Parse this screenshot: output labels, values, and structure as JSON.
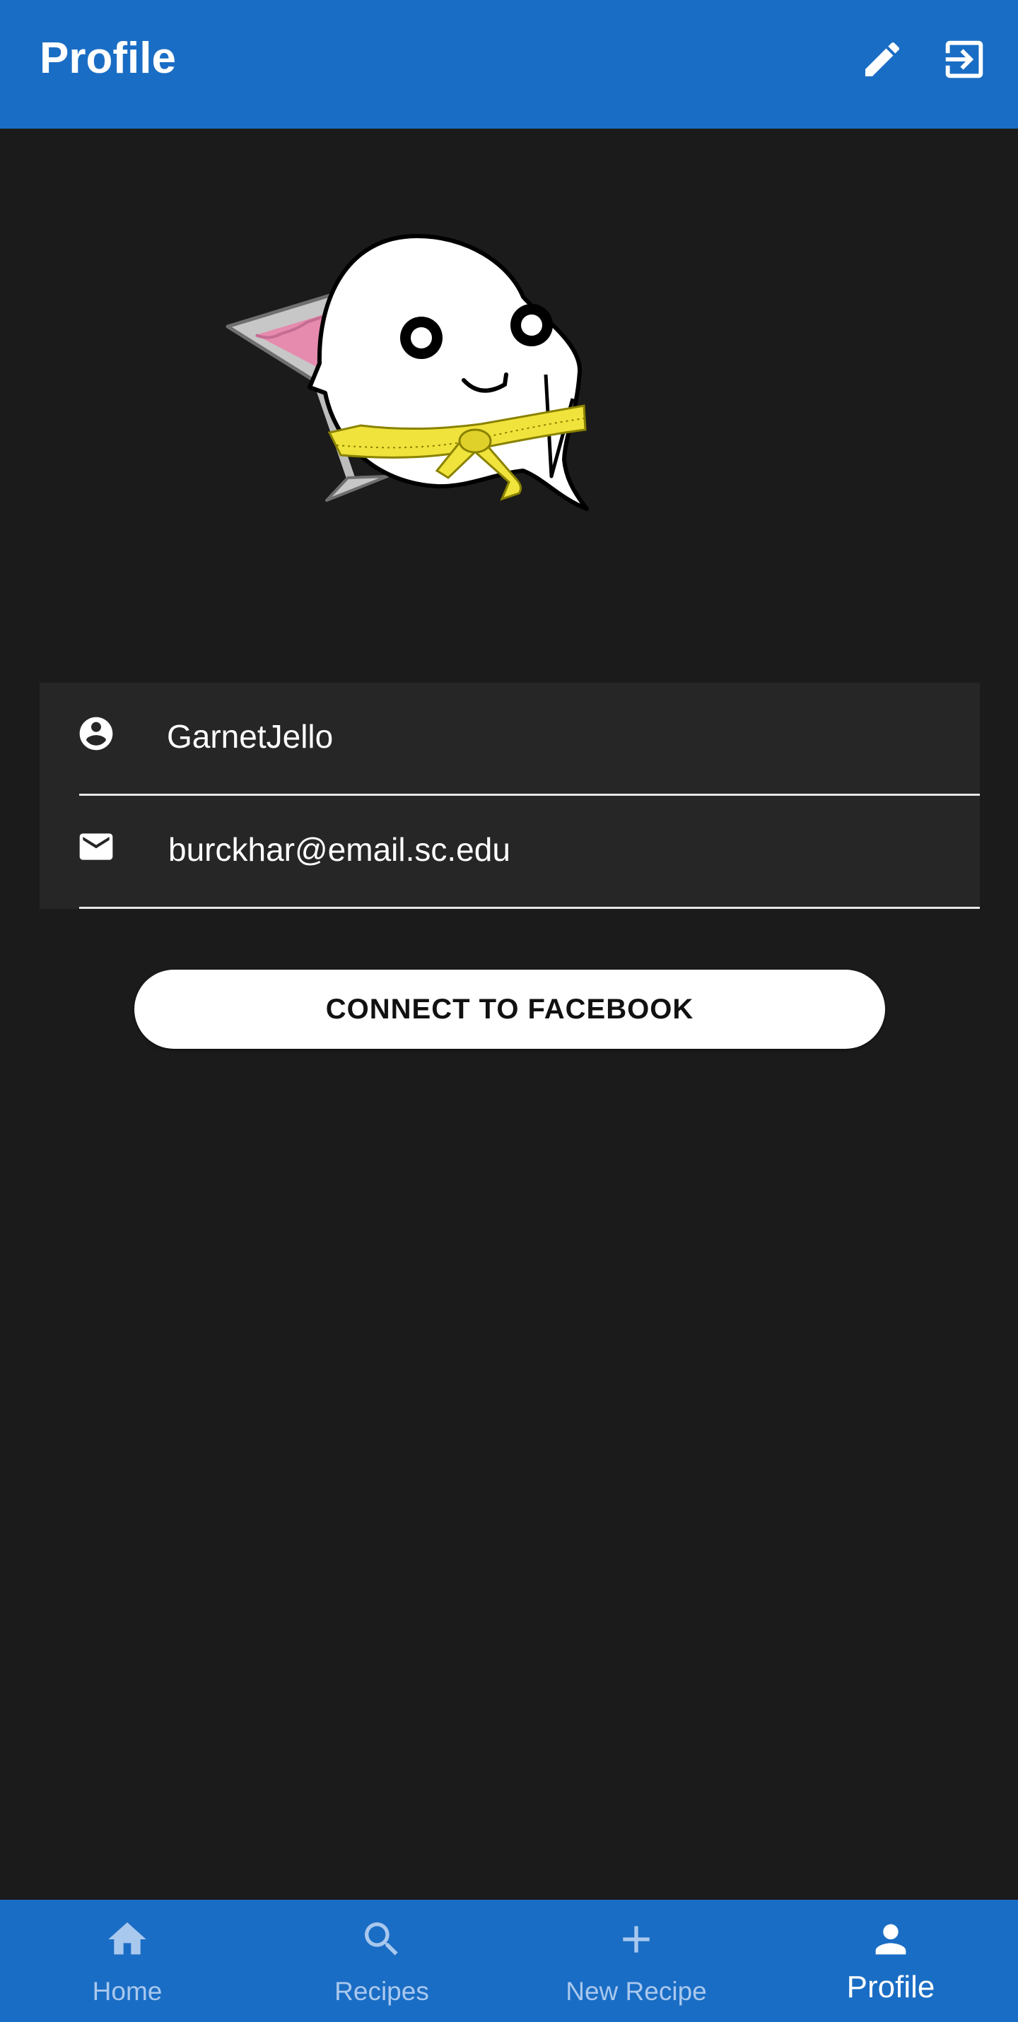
{
  "app_bar": {
    "title": "Profile",
    "edit_icon": "pencil-icon",
    "logout_icon": "exit-icon",
    "background": "#1a6dc4"
  },
  "profile": {
    "avatar": "ghost-mascot-with-martini",
    "username": "GarnetJello",
    "username_icon": "account-circle-icon",
    "email": "burckhar@email.sc.edu",
    "email_icon": "mail-icon"
  },
  "actions": {
    "connect_facebook_label": "CONNECT TO FACEBOOK"
  },
  "bottom_nav": {
    "items": [
      {
        "label": "Home",
        "icon": "home-icon",
        "active": false
      },
      {
        "label": "Recipes",
        "icon": "search-icon",
        "active": false
      },
      {
        "label": "New Recipe",
        "icon": "plus-icon",
        "active": false
      },
      {
        "label": "Profile",
        "icon": "person-icon",
        "active": true
      }
    ]
  },
  "colors": {
    "accent": "#1a6dc4",
    "background": "#1b1b1b",
    "card": "#262626"
  }
}
